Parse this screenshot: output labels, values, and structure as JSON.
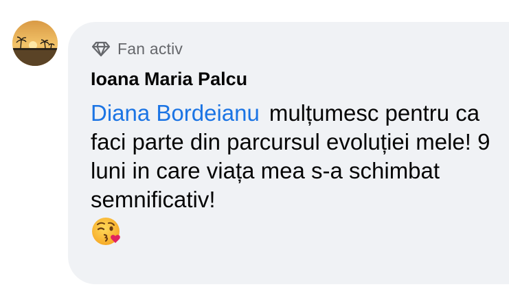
{
  "comment": {
    "badge_label": "Fan activ",
    "badge_icon": "diamond-icon",
    "author_name": "Ioana Maria Palcu",
    "mention": "Diana Bordeianu",
    "body_text": "mulțumesc pentru ca faci parte din parcursul evoluției mele! 9 luni in care viața mea s-a schimbat semnificativ!",
    "emoji": "kissing-face-winking-icon"
  },
  "colors": {
    "bubble_background": "#f0f2f5",
    "mention": "#1b74e4",
    "badge_text": "#65676b",
    "text": "#050505"
  }
}
